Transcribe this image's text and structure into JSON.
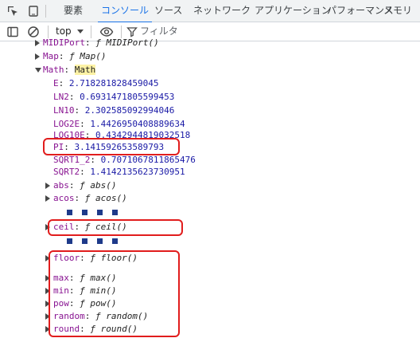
{
  "tabs": {
    "items": [
      "要素",
      "コンソール",
      "ソース",
      "ネットワーク",
      "アプリケーション",
      "パフォーマンス",
      "メモリ"
    ],
    "active_index": 1
  },
  "toolbar": {
    "context": "top",
    "filter_placeholder": "フィルタ"
  },
  "console": {
    "lines": [
      {
        "key": "MIDIPort",
        "value": "ƒ MIDIPort()"
      },
      {
        "key": "Map",
        "value": "ƒ Map()"
      },
      {
        "key": "Math",
        "value": "Math"
      },
      {
        "key": "E",
        "value": "2.718281828459045"
      },
      {
        "key": "LN2",
        "value": "0.6931471805599453"
      },
      {
        "key": "LN10",
        "value": "2.302585092994046"
      },
      {
        "key": "LOG2E",
        "value": "1.4426950408889634"
      },
      {
        "key": "LOG10E",
        "value": "0.4342944819032518"
      },
      {
        "key": "PI",
        "value": "3.141592653589793"
      },
      {
        "key": "SQRT1_2",
        "value": "0.7071067811865476"
      },
      {
        "key": "SQRT2",
        "value": "1.4142135623730951"
      },
      {
        "key": "abs",
        "value": "ƒ abs()"
      },
      {
        "key": "acos",
        "value": "ƒ acos()"
      },
      {
        "key": "ceil",
        "value": "ƒ ceil()"
      },
      {
        "key": "floor",
        "value": "ƒ floor()"
      },
      {
        "key": "max",
        "value": "ƒ max()"
      },
      {
        "key": "min",
        "value": "ƒ min()"
      },
      {
        "key": "pow",
        "value": "ƒ pow()"
      },
      {
        "key": "random",
        "value": "ƒ random()"
      },
      {
        "key": "round",
        "value": "ƒ round()"
      }
    ]
  },
  "colors": {
    "accent": "#1a73e8",
    "highlight_box": "#e11d1d",
    "ellipsis_dots": "#1e3a8a",
    "property_key": "#881391",
    "number_value": "#1a1aa6"
  }
}
